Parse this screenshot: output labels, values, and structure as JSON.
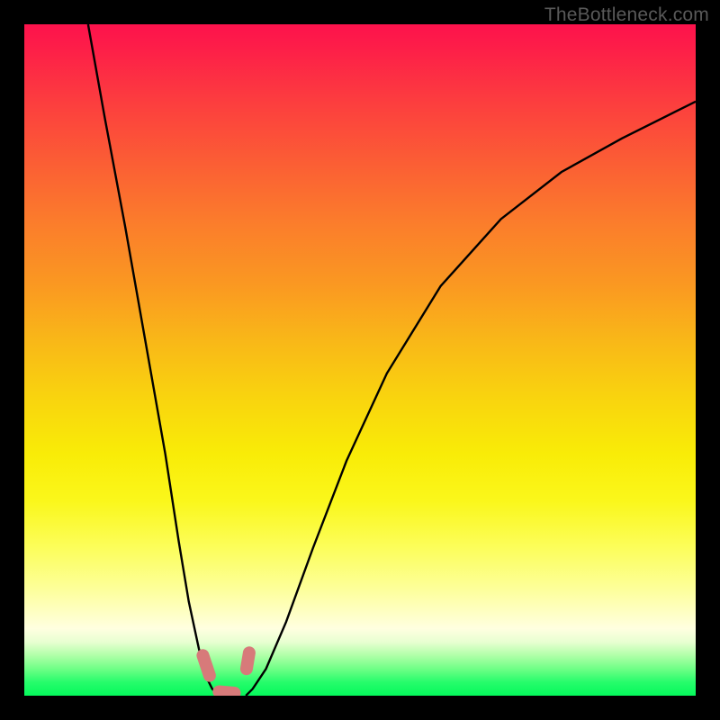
{
  "watermark": "TheBottleneck.com",
  "chart_data": {
    "type": "line",
    "title": "",
    "xlabel": "",
    "ylabel": "",
    "xlim": [
      0,
      100
    ],
    "ylim": [
      0,
      100
    ],
    "series": [
      {
        "name": "left-curve",
        "x": [
          9.5,
          12,
          15,
          18,
          21,
          23,
          24.5,
          26,
          27,
          28,
          29
        ],
        "y": [
          100,
          86,
          70,
          53,
          36,
          23,
          14,
          7,
          3,
          1,
          0
        ]
      },
      {
        "name": "right-curve",
        "x": [
          33,
          34,
          36,
          39,
          43,
          48,
          54,
          62,
          71,
          80,
          89,
          97,
          100
        ],
        "y": [
          0,
          1,
          4,
          11,
          22,
          35,
          48,
          61,
          71,
          78,
          83,
          87,
          88.5
        ]
      }
    ],
    "markers": [
      {
        "name": "left-upper",
        "points": [
          [
            26.6,
            6.0
          ],
          [
            27.6,
            3.0
          ]
        ]
      },
      {
        "name": "right-upper",
        "points": [
          [
            33.5,
            6.4
          ],
          [
            33.1,
            4.0
          ]
        ]
      },
      {
        "name": "bottom",
        "points": [
          [
            29.0,
            0.6
          ],
          [
            31.3,
            0.4
          ]
        ]
      }
    ],
    "colors": {
      "curve": "#000000",
      "marker": "#d77a7a",
      "gradient_top": "#fd124c",
      "gradient_bottom": "#05f95c"
    }
  }
}
